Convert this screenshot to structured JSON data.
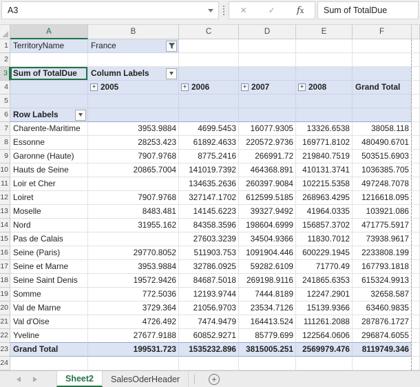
{
  "formula_bar": {
    "cell_reference": "A3",
    "formula_text": "Sum of TotalDue"
  },
  "grid": {
    "column_letters": [
      "A",
      "B",
      "C",
      "D",
      "E",
      "F"
    ],
    "selected_cell": "A3",
    "selected_column": "A",
    "selected_row": 3,
    "row_count": 24,
    "filter": {
      "label": "TerritoryName",
      "value": "France"
    },
    "pivot": {
      "title": "Sum of TotalDue",
      "column_labels": "Column Labels",
      "row_labels": "Row Labels",
      "year_headers": [
        "2005",
        "2006",
        "2007",
        "2008"
      ],
      "grand_total_header": "Grand Total",
      "data_rows": [
        {
          "label": "Charente-Maritime",
          "values": [
            "3953.9884",
            "4699.5453",
            "16077.9305",
            "13326.6538",
            "38058.118"
          ]
        },
        {
          "label": "Essonne",
          "values": [
            "28253.423",
            "61892.4633",
            "220572.9736",
            "169771.8102",
            "480490.6701"
          ]
        },
        {
          "label": "Garonne (Haute)",
          "values": [
            "7907.9768",
            "8775.2416",
            "266991.72",
            "219840.7519",
            "503515.6903"
          ]
        },
        {
          "label": "Hauts de Seine",
          "values": [
            "20865.7004",
            "141019.7392",
            "464368.891",
            "410131.3741",
            "1036385.705"
          ]
        },
        {
          "label": "Loir et Cher",
          "values": [
            "",
            "134635.2636",
            "260397.9084",
            "102215.5358",
            "497248.7078"
          ]
        },
        {
          "label": "Loiret",
          "values": [
            "7907.9768",
            "327147.1702",
            "612599.5185",
            "268963.4295",
            "1216618.095"
          ]
        },
        {
          "label": "Moselle",
          "values": [
            "8483.481",
            "14145.6223",
            "39327.9492",
            "41964.0335",
            "103921.086"
          ]
        },
        {
          "label": "Nord",
          "values": [
            "31955.162",
            "84358.3596",
            "198604.6999",
            "156857.3702",
            "471775.5917"
          ]
        },
        {
          "label": "Pas de Calais",
          "values": [
            "",
            "27603.3239",
            "34504.9366",
            "11830.7012",
            "73938.9617"
          ]
        },
        {
          "label": "Seine (Paris)",
          "values": [
            "29770.8052",
            "511903.753",
            "1091904.446",
            "600229.1945",
            "2233808.199"
          ]
        },
        {
          "label": "Seine et Marne",
          "values": [
            "3953.9884",
            "32786.0925",
            "59282.6109",
            "71770.49",
            "167793.1818"
          ]
        },
        {
          "label": "Seine Saint Denis",
          "values": [
            "19572.9426",
            "84687.5018",
            "269198.9116",
            "241865.6353",
            "615324.9913"
          ]
        },
        {
          "label": "Somme",
          "values": [
            "772.5036",
            "12193.9744",
            "7444.8189",
            "12247.2901",
            "32658.587"
          ]
        },
        {
          "label": "Val de Marne",
          "values": [
            "3729.364",
            "21056.9703",
            "23534.7126",
            "15139.9366",
            "63460.9835"
          ]
        },
        {
          "label": "Val d'Oise",
          "values": [
            "4726.492",
            "7474.9479",
            "164413.524",
            "111261.2088",
            "287876.1727"
          ]
        },
        {
          "label": "Yveline",
          "values": [
            "27677.9188",
            "60852.9271",
            "85779.699",
            "122564.0606",
            "296874.6055"
          ]
        }
      ],
      "grand_total_row": {
        "label": "Grand Total",
        "values": [
          "199531.723",
          "1535232.896",
          "3815005.251",
          "2569979.476",
          "8119749.346"
        ]
      }
    }
  },
  "sheet_tabs": {
    "active": "Sheet2",
    "inactive": "SalesOderHeader",
    "add_label": "+"
  },
  "colors": {
    "accent_green": "#217346",
    "pivot_fill": "#DCE3F2",
    "selection_border": "#217346"
  }
}
